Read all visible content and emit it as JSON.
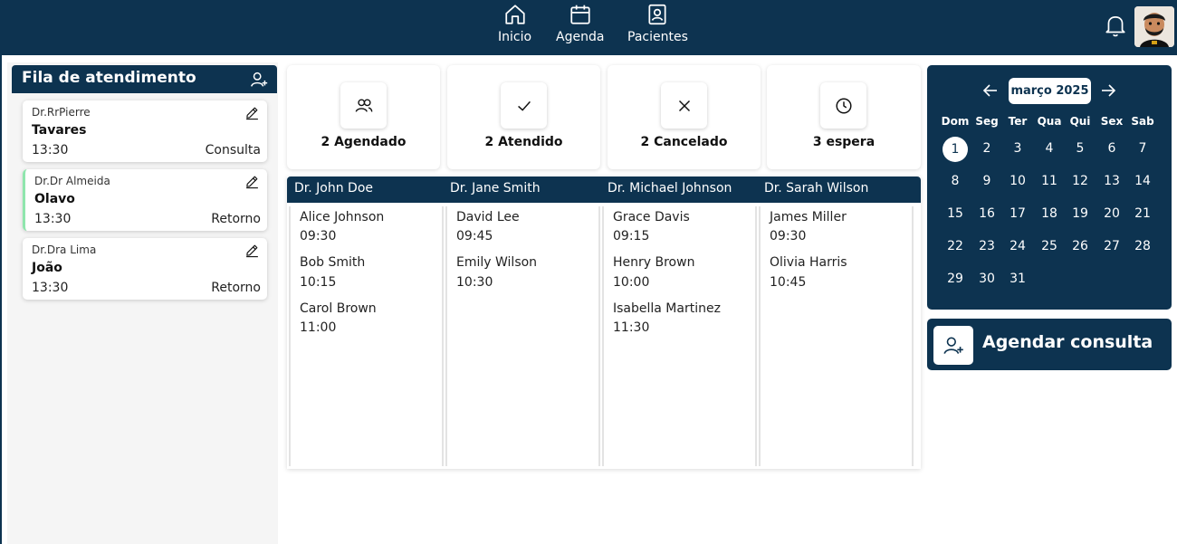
{
  "nav": {
    "items": [
      {
        "label": "Inicio",
        "icon": "home-icon"
      },
      {
        "label": "Agenda",
        "icon": "calendar-icon"
      },
      {
        "label": "Pacientes",
        "icon": "patient-card-icon"
      }
    ]
  },
  "queue": {
    "title": "Fila de atendimento",
    "items": [
      {
        "doctor": "Dr.RrPierre",
        "patient": "Tavares",
        "time": "13:30",
        "type": "Consulta"
      },
      {
        "doctor": "Dr.Dr Almeida",
        "patient": "Olavo",
        "time": "13:30",
        "type": "Retorno"
      },
      {
        "doctor": "Dr.Dra Lima",
        "patient": "João",
        "time": "13:30",
        "type": "Retorno"
      }
    ]
  },
  "stats": [
    {
      "label": "2 Agendado",
      "icon": "users-icon"
    },
    {
      "label": "2 Atendido",
      "icon": "check-icon"
    },
    {
      "label": "2 Cancelado",
      "icon": "x-icon"
    },
    {
      "label": "3 espera",
      "icon": "clock-icon"
    }
  ],
  "schedule": {
    "doctors": [
      {
        "name": "Dr. John Doe",
        "appointments": [
          {
            "patient": "Alice Johnson",
            "time": "09:30"
          },
          {
            "patient": "Bob Smith",
            "time": "10:15"
          },
          {
            "patient": "Carol Brown",
            "time": "11:00"
          }
        ]
      },
      {
        "name": "Dr. Jane Smith",
        "appointments": [
          {
            "patient": "David Lee",
            "time": "09:45"
          },
          {
            "patient": "Emily Wilson",
            "time": "10:30"
          }
        ]
      },
      {
        "name": "Dr. Michael Johnson",
        "appointments": [
          {
            "patient": "Grace Davis",
            "time": "09:15"
          },
          {
            "patient": "Henry Brown",
            "time": "10:00"
          },
          {
            "patient": "Isabella Martinez",
            "time": "11:30"
          }
        ]
      },
      {
        "name": "Dr. Sarah Wilson",
        "appointments": [
          {
            "patient": "James Miller",
            "time": "09:30"
          },
          {
            "patient": "Olivia Harris",
            "time": "10:45"
          }
        ]
      }
    ]
  },
  "calendar": {
    "month_label": "março 2025",
    "weekdays": [
      "Dom",
      "Seg",
      "Ter",
      "Qua",
      "Qui",
      "Sex",
      "Sab"
    ],
    "days": [
      "1",
      "2",
      "3",
      "4",
      "5",
      "6",
      "7",
      "8",
      "9",
      "10",
      "11",
      "12",
      "13",
      "14",
      "15",
      "16",
      "17",
      "18",
      "19",
      "20",
      "21",
      "22",
      "23",
      "24",
      "25",
      "26",
      "27",
      "28",
      "29",
      "30",
      "31"
    ],
    "selected_day": "1"
  },
  "booking": {
    "label": "Agendar consulta"
  },
  "colors": {
    "primary": "#0d3350",
    "accent": "#8fe6ad"
  }
}
